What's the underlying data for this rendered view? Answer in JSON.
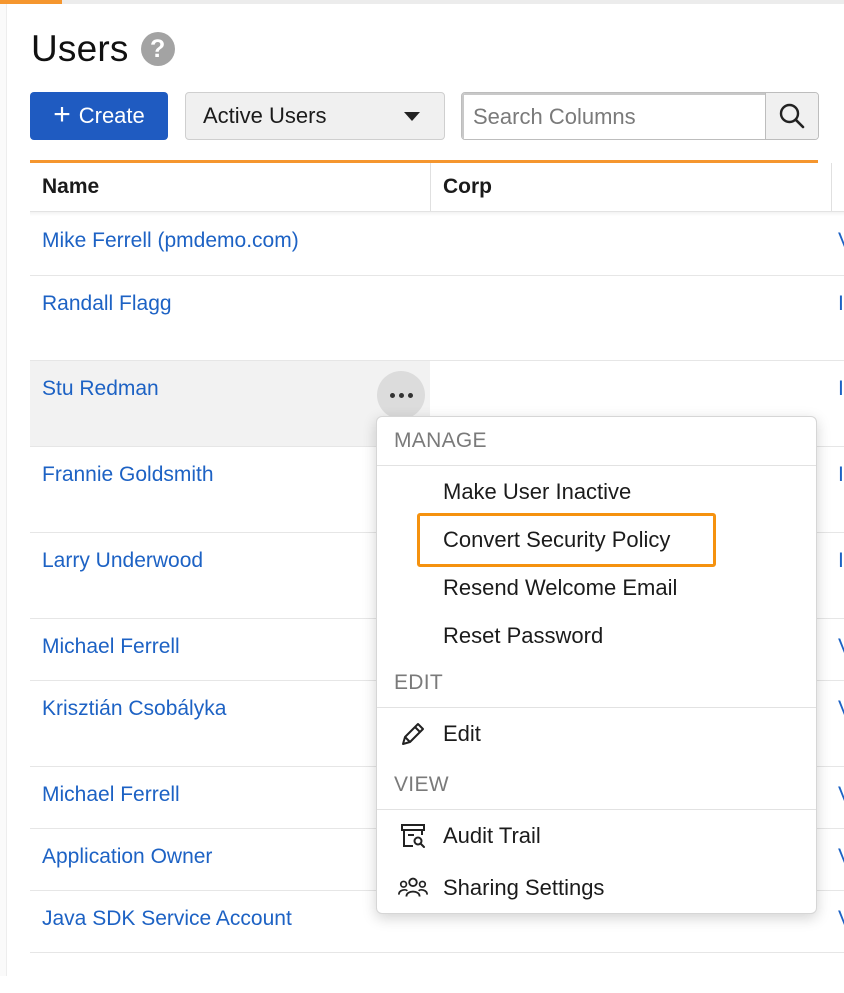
{
  "header": {
    "title": "Users",
    "help_glyph": "?"
  },
  "toolbar": {
    "create_plus": "+",
    "create_label": "Create",
    "view_selected": "Active Users",
    "search_placeholder": "Search Columns",
    "search_value": ""
  },
  "table": {
    "columns": [
      "Name",
      "Corp"
    ],
    "rows": [
      {
        "name": "Mike Ferrell (pmdemo.com)",
        "edge": "V"
      },
      {
        "name": "Randall Flagg",
        "edge": "I"
      },
      {
        "name": "Stu Redman",
        "edge": "I"
      },
      {
        "name": "Frannie Goldsmith",
        "edge": "I"
      },
      {
        "name": "Larry Underwood",
        "edge": "I"
      },
      {
        "name": "Michael Ferrell",
        "edge": "V"
      },
      {
        "name": "Krisztián Csobályka",
        "edge": "V"
      },
      {
        "name": "Michael Ferrell",
        "edge": "V"
      },
      {
        "name": "Application Owner",
        "edge": "V"
      },
      {
        "name": "Java SDK Service Account",
        "edge": "V"
      }
    ]
  },
  "menu": {
    "sections": {
      "manage": "MANAGE",
      "edit": "EDIT",
      "view": "VIEW"
    },
    "items": {
      "make_inactive": "Make User Inactive",
      "convert_policy": "Convert Security Policy",
      "resend_email": "Resend Welcome Email",
      "reset_password": "Reset Password",
      "edit": "Edit",
      "audit_trail": "Audit Trail",
      "sharing_settings": "Sharing Settings"
    }
  },
  "colors": {
    "primary": "#1f5bc1",
    "link": "#1d62c4",
    "accent_orange": "#f5962e",
    "focus_orange": "#f5920f"
  },
  "icons": {
    "help": "help-icon",
    "plus": "plus-icon",
    "caret": "caret-down-icon",
    "search": "search-icon",
    "more": "more-horizontal-icon",
    "edit": "pencil-icon",
    "audit": "audit-trail-icon",
    "sharing": "people-group-icon"
  }
}
